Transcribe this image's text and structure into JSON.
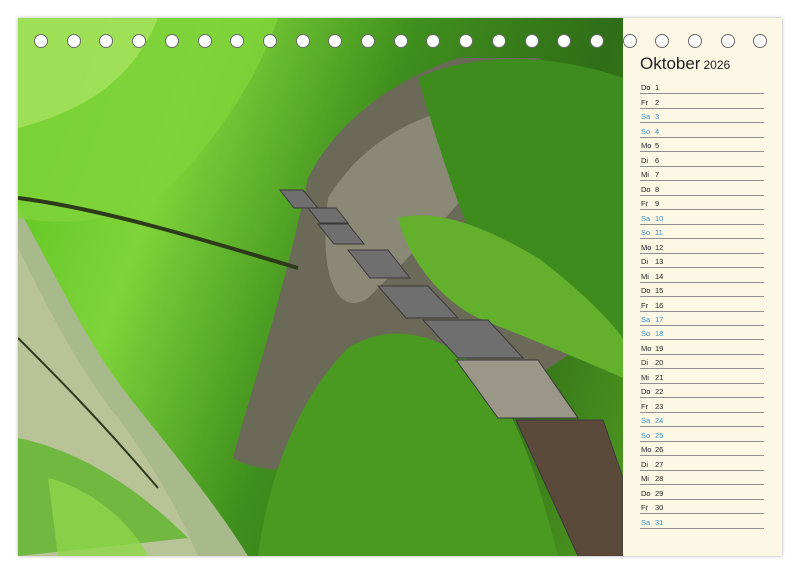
{
  "calendar": {
    "month": "Oktober",
    "year": "2026",
    "weekend_color": "#3a8fc9",
    "days": [
      {
        "dn": "Do",
        "d": "1",
        "weekend": false
      },
      {
        "dn": "Fr",
        "d": "2",
        "weekend": false
      },
      {
        "dn": "Sa",
        "d": "3",
        "weekend": true
      },
      {
        "dn": "So",
        "d": "4",
        "weekend": true
      },
      {
        "dn": "Mo",
        "d": "5",
        "weekend": false
      },
      {
        "dn": "Di",
        "d": "6",
        "weekend": false
      },
      {
        "dn": "Mi",
        "d": "7",
        "weekend": false
      },
      {
        "dn": "Do",
        "d": "8",
        "weekend": false
      },
      {
        "dn": "Fr",
        "d": "9",
        "weekend": false
      },
      {
        "dn": "Sa",
        "d": "10",
        "weekend": true
      },
      {
        "dn": "So",
        "d": "11",
        "weekend": true
      },
      {
        "dn": "Mo",
        "d": "12",
        "weekend": false
      },
      {
        "dn": "Di",
        "d": "13",
        "weekend": false
      },
      {
        "dn": "Mi",
        "d": "14",
        "weekend": false
      },
      {
        "dn": "Do",
        "d": "15",
        "weekend": false
      },
      {
        "dn": "Fr",
        "d": "16",
        "weekend": false
      },
      {
        "dn": "Sa",
        "d": "17",
        "weekend": true
      },
      {
        "dn": "So",
        "d": "18",
        "weekend": true
      },
      {
        "dn": "Mo",
        "d": "19",
        "weekend": false
      },
      {
        "dn": "Di",
        "d": "20",
        "weekend": false
      },
      {
        "dn": "Mi",
        "d": "21",
        "weekend": false
      },
      {
        "dn": "Do",
        "d": "22",
        "weekend": false
      },
      {
        "dn": "Fr",
        "d": "23",
        "weekend": false
      },
      {
        "dn": "Sa",
        "d": "24",
        "weekend": true
      },
      {
        "dn": "So",
        "d": "25",
        "weekend": true
      },
      {
        "dn": "Mo",
        "d": "26",
        "weekend": false
      },
      {
        "dn": "Di",
        "d": "27",
        "weekend": false
      },
      {
        "dn": "Mi",
        "d": "28",
        "weekend": false
      },
      {
        "dn": "Do",
        "d": "29",
        "weekend": false
      },
      {
        "dn": "Fr",
        "d": "30",
        "weekend": false
      },
      {
        "dn": "Sa",
        "d": "31",
        "weekend": true
      }
    ]
  }
}
